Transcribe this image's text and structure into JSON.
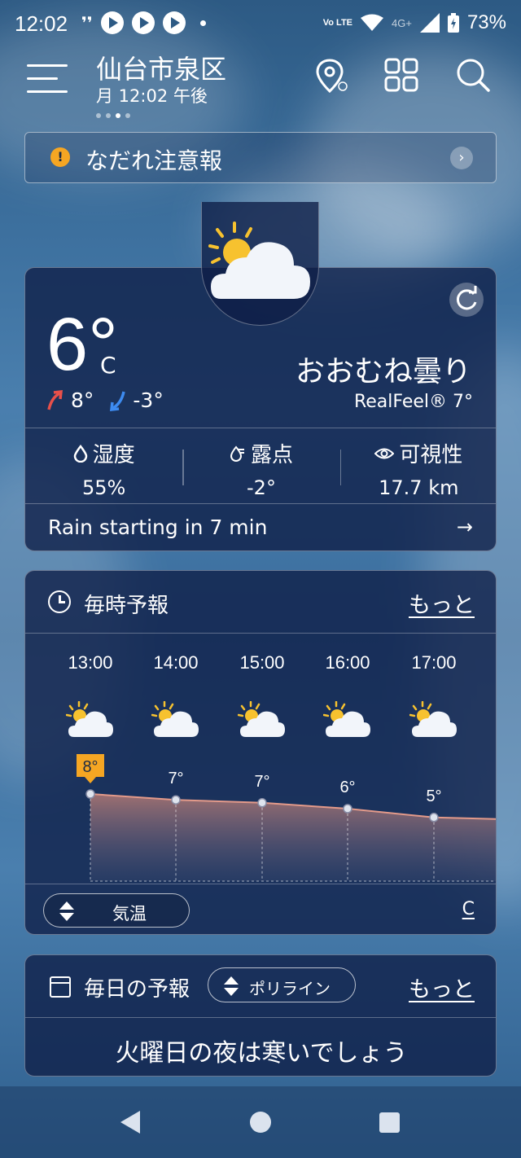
{
  "status_bar": {
    "time": "12:02",
    "network": "4G+",
    "battery": "73%",
    "volte": "Vo LTE"
  },
  "header": {
    "location": "仙台市泉区",
    "datetime": "月 12:02 午後"
  },
  "alert": {
    "text": "なだれ注意報",
    "icon": "!"
  },
  "current": {
    "temperature": "6°",
    "unit": "C",
    "high": "8°",
    "low": "-3°",
    "condition": "おおむね曇り",
    "realfeel": "RealFeel® 7°",
    "humidity_label": "湿度",
    "humidity": "55%",
    "dewpoint_label": "露点",
    "dewpoint": "-2°",
    "visibility_label": "可視性",
    "visibility": "17.7 km",
    "rain_text": "Rain starting in 7 min",
    "rain_arrow": "→"
  },
  "hourly": {
    "title": "毎時予報",
    "more": "もっと",
    "hours": [
      {
        "time": "13:00",
        "temp": "8°",
        "value": 8,
        "icon": "partly-cloudy-icon"
      },
      {
        "time": "14:00",
        "temp": "7°",
        "value": 7.4,
        "icon": "partly-cloudy-icon"
      },
      {
        "time": "15:00",
        "temp": "7°",
        "value": 7.1,
        "icon": "partly-cloudy-icon"
      },
      {
        "time": "16:00",
        "temp": "6°",
        "value": 6.5,
        "icon": "partly-cloudy-icon"
      },
      {
        "time": "17:00",
        "temp": "5°",
        "value": 5.6,
        "icon": "partly-cloudy-icon"
      }
    ],
    "metric_label": "気温",
    "unit": "C"
  },
  "daily": {
    "title": "毎日の予報",
    "mode": "ポリライン",
    "more": "もっと",
    "message": "火曜日の夜は寒いでしょう"
  },
  "colors": {
    "accent": "#f5a623",
    "card_bg": "#0e1e46",
    "high_arrow": "#e8504a",
    "low_arrow": "#3d8bf0",
    "chart_line": "#e39a8a"
  }
}
